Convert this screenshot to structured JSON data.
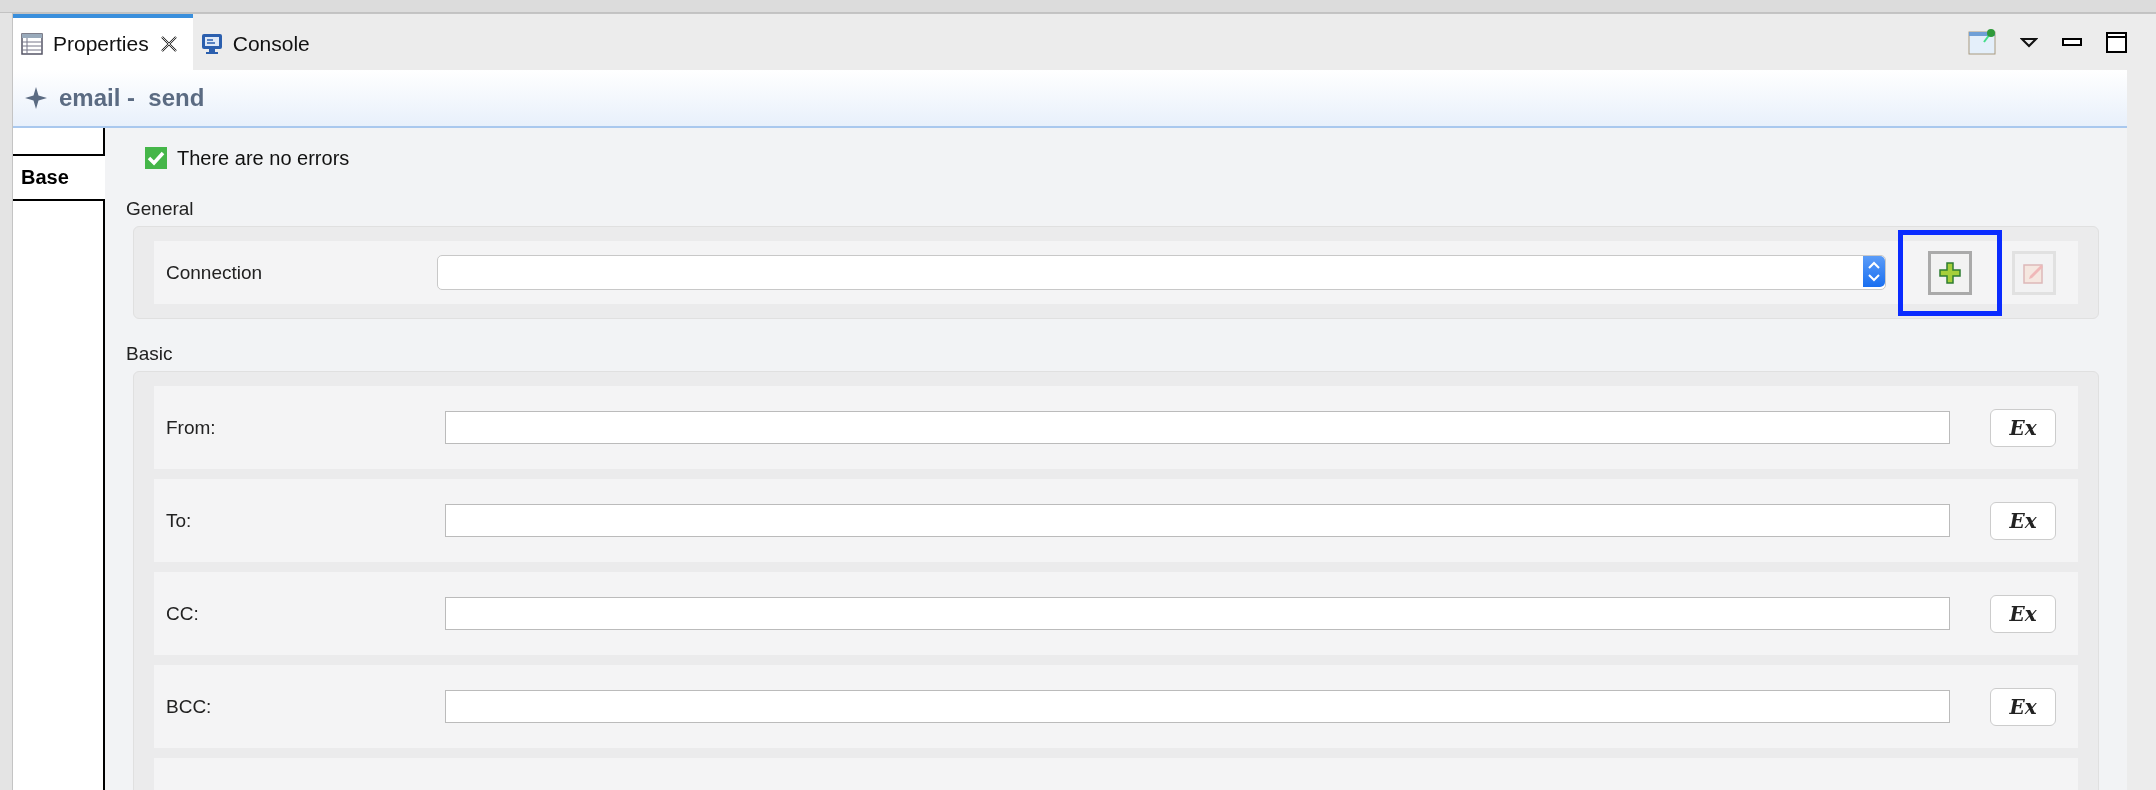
{
  "tabs": [
    {
      "label": "Properties",
      "selected": true,
      "closable": true,
      "kind": "table"
    },
    {
      "label": "Console",
      "selected": false,
      "closable": false,
      "kind": "monitor"
    }
  ],
  "title": "email -  send",
  "side_tabs": [
    {
      "label": "Base",
      "selected": true
    }
  ],
  "status": {
    "text": "There are no errors"
  },
  "sections": [
    {
      "title": "General",
      "rows": [
        {
          "kind": "select",
          "label": "Connection",
          "add_highlighted": true,
          "edit_disabled": true
        }
      ]
    },
    {
      "title": "Basic",
      "rows": [
        {
          "kind": "text",
          "label": "From:",
          "button": "Ex"
        },
        {
          "kind": "text",
          "label": "To:",
          "button": "Ex"
        },
        {
          "kind": "text",
          "label": "CC:",
          "button": "Ex"
        },
        {
          "kind": "text",
          "label": "BCC:",
          "button": "Ex"
        },
        {
          "kind": "blank"
        }
      ]
    }
  ]
}
